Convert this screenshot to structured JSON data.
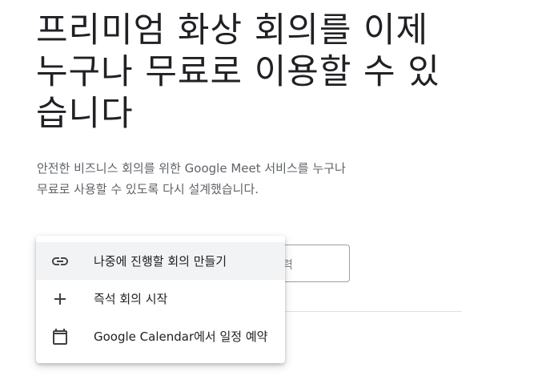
{
  "hero": {
    "headline_lines": [
      "프리미엄 화상 회의를 이제",
      "누구나 무료로 이용할 수 있",
      "습니다"
    ],
    "subtitle_lines": [
      "안전한 비즈니스 회의를 위한 Google Meet 서비스를 누구나",
      "무료로 사용할 수 있도록 다시 설계했습니다."
    ]
  },
  "join": {
    "input_hint_fragment": "력"
  },
  "menu": {
    "items": [
      {
        "label": "나중에 진행할 회의 만들기",
        "icon": "link-icon",
        "active": true
      },
      {
        "label": "즉석 회의 시작",
        "icon": "plus-icon",
        "active": false
      },
      {
        "label": "Google Calendar에서 일정 예약",
        "icon": "calendar-icon",
        "active": false
      }
    ]
  },
  "colors": {
    "text_primary": "#202124",
    "text_secondary": "#5f6368",
    "menu_hover": "#f1f3f4"
  }
}
